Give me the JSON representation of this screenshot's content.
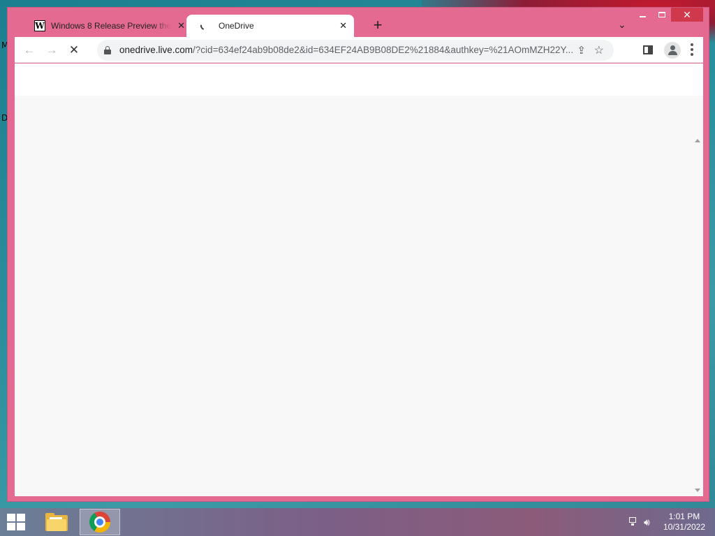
{
  "desktop": {
    "icon_label_1": "M",
    "icon_label_2": "D"
  },
  "browser": {
    "tabs": [
      {
        "title": "Windows 8 Release Preview ther",
        "favicon": "W",
        "active": false
      },
      {
        "title": "OneDrive",
        "favicon": "loading-spinner-icon",
        "active": true
      }
    ],
    "new_tab_symbol": "+",
    "tab_close_symbol": "✕",
    "tab_search_symbol": "⌄",
    "window_controls": {
      "minimize": "",
      "maximize": "",
      "close": "✕"
    },
    "toolbar": {
      "back_symbol": "←",
      "forward_symbol": "→",
      "stop_symbol": "✕"
    },
    "address_bar": {
      "host": "onedrive.live.com",
      "path": "/?cid=634ef24ab9b08de2&id=634EF24AB9B08DE2%21884&authkey=%21AOmMZH22Y..."
    },
    "icons": {
      "share": "share-icon",
      "bookmark": "star-icon",
      "side_panel": "side-panel-icon",
      "profile": "profile-icon",
      "menu": "more-menu-icon"
    }
  },
  "taskbar": {
    "apps": [
      "file-explorer",
      "google-chrome"
    ],
    "clock": {
      "time": "1:01 PM",
      "date": "10/31/2022"
    }
  },
  "colors": {
    "window_frame": "#e56a92",
    "close_button": "#d0394b",
    "page_background": "#f8f8f8"
  }
}
